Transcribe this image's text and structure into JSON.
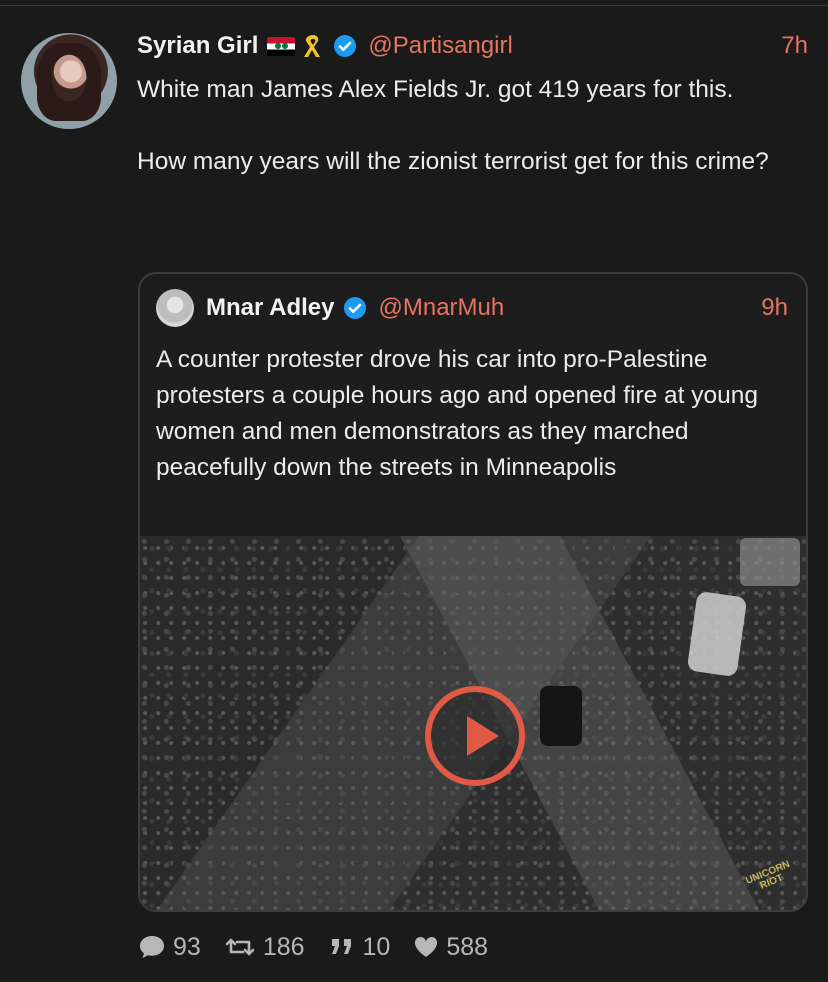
{
  "tweet": {
    "author_name": "Syrian Girl",
    "author_handle": "@Partisangirl",
    "time": "7h",
    "text": "White man James Alex Fields Jr. got 419 years for this.\n\nHow many years will the zionist terrorist get for this crime?",
    "badges": [
      "syria-flag-icon",
      "yellow-ribbon-icon",
      "verified-icon"
    ]
  },
  "quoted": {
    "author_name": "Mnar Adley",
    "author_handle": "@MnarMuh",
    "time": "9h",
    "text": "A counter protester drove his car into pro-Palestine protesters a couple hours ago and opened fire at young women and men demonstrators as they marched peacefully down the streets in Minneapolis",
    "media": {
      "type": "video",
      "watermark": "UNICORN RIOT"
    }
  },
  "stats": {
    "replies": "93",
    "retweets": "186",
    "quotes": "10",
    "likes": "588"
  },
  "colors": {
    "background": "#1a1a1b",
    "accent": "#e8735e",
    "verified": "#1d9bf0",
    "text": "#ececec",
    "muted": "#b7b7b7"
  }
}
